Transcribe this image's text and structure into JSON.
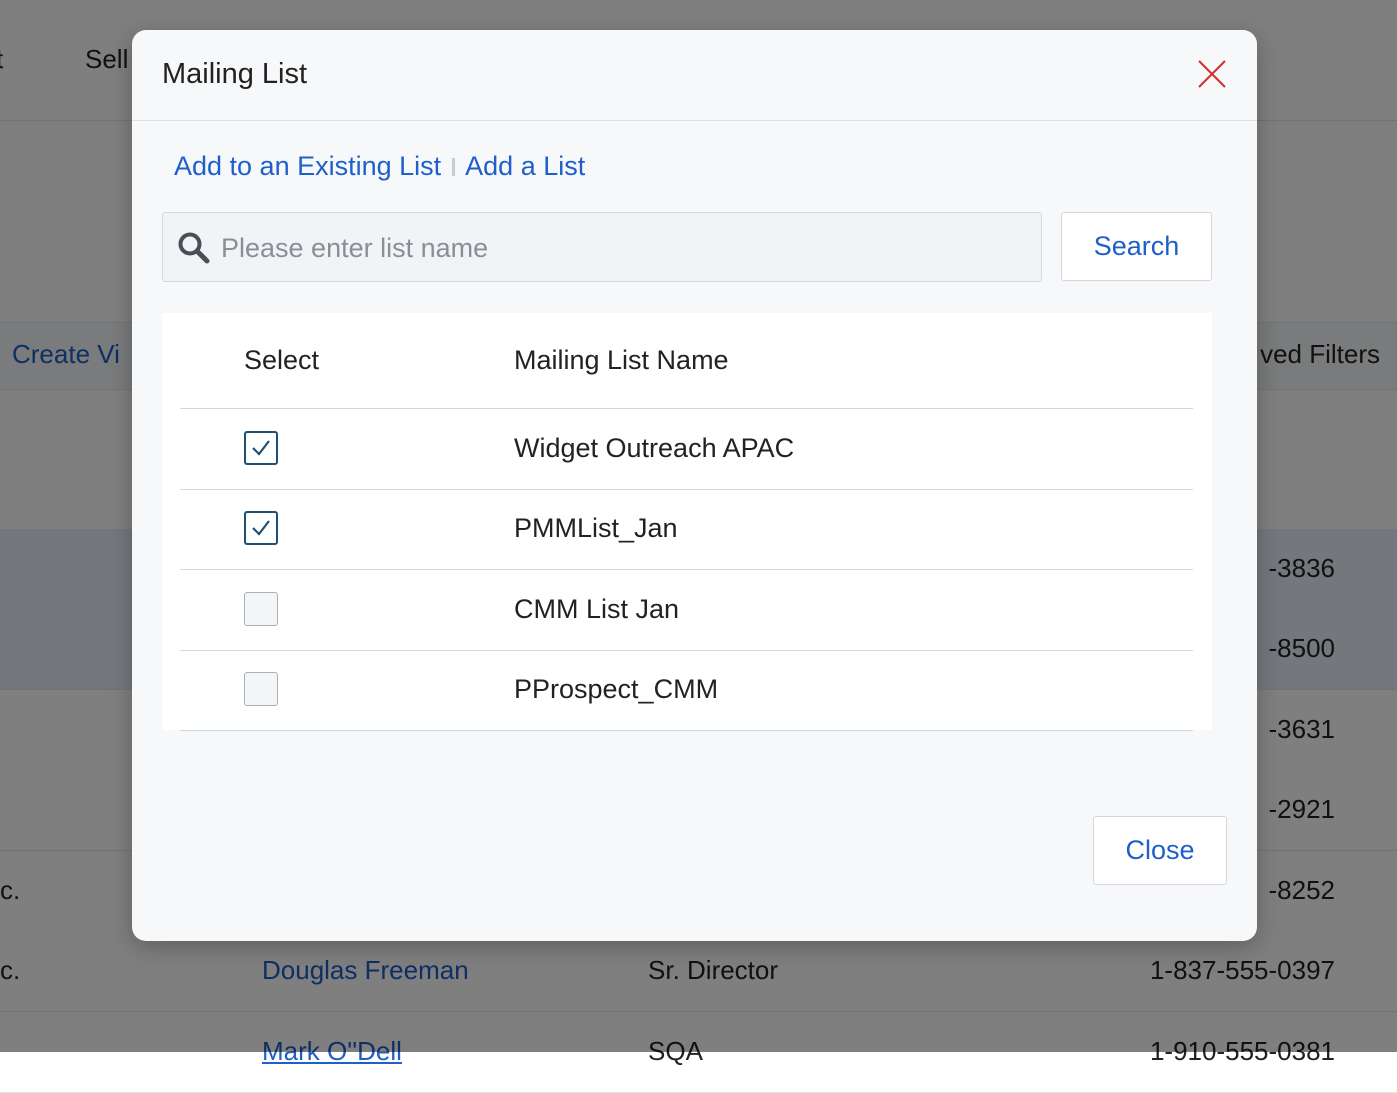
{
  "background": {
    "nav_tabs": [
      "t",
      "Sell"
    ],
    "toolbar": {
      "create_view": "Create Vi",
      "saved_filters": "ved Filters"
    },
    "rows": [
      {
        "company": "",
        "name": "",
        "title": "",
        "phone": "-3836"
      },
      {
        "company": "",
        "name": "",
        "title": "",
        "phone": "-8500"
      },
      {
        "company": "",
        "name": "",
        "title": "",
        "phone": "-3631"
      },
      {
        "company": "",
        "name": "",
        "title": "",
        "phone": "-2921"
      },
      {
        "company": "c.",
        "name": "",
        "title": "",
        "phone": "-8252"
      },
      {
        "company": "c.",
        "name": "Douglas Freeman",
        "title": "Sr. Director",
        "phone": "1-837-555-0397"
      },
      {
        "company": "",
        "name": "Mark O''Dell",
        "title": "SQA",
        "phone": "1-910-555-0381"
      }
    ]
  },
  "modal": {
    "title": "Mailing List",
    "links": {
      "existing": "Add to an Existing List",
      "add": "Add a List"
    },
    "search": {
      "placeholder": "Please enter list name",
      "value": "",
      "button_label": "Search"
    },
    "table": {
      "headers": {
        "select": "Select",
        "name": "Mailing List Name"
      },
      "rows": [
        {
          "name": "Widget Outreach APAC",
          "checked": true
        },
        {
          "name": "PMMList_Jan",
          "checked": true
        },
        {
          "name": "CMM List Jan",
          "checked": false
        },
        {
          "name": "PProspect_CMM",
          "checked": false
        }
      ]
    },
    "close_label": "Close"
  },
  "colors": {
    "link": "#1f5fc9",
    "close_x": "#d32f2f",
    "checkbox_checked": "#1d4f72"
  }
}
